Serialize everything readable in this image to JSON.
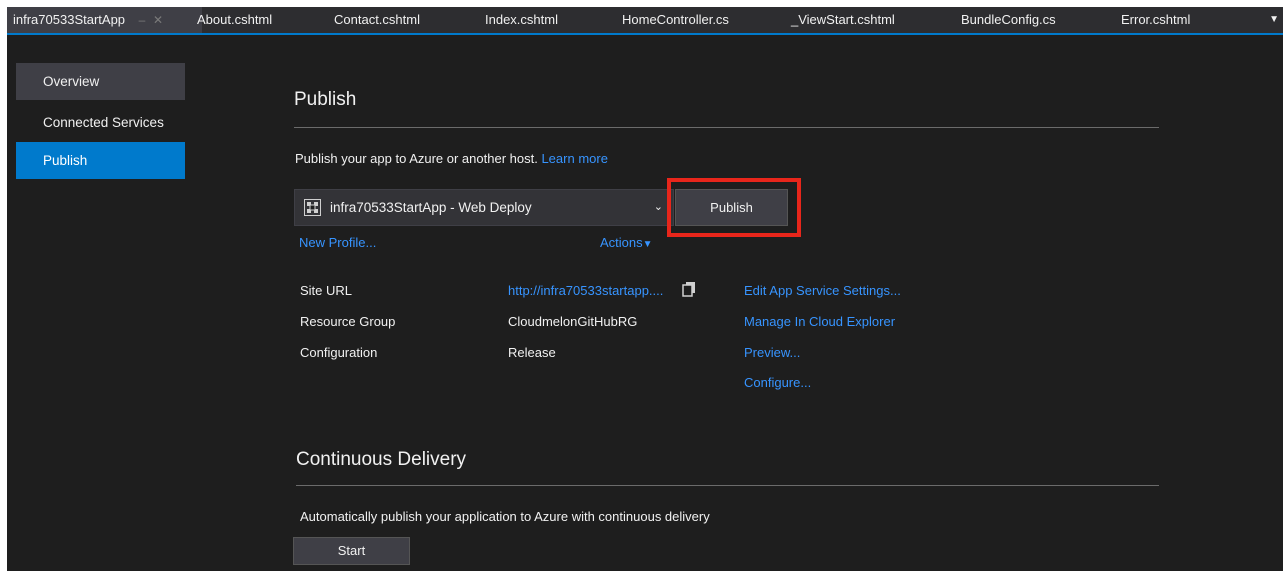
{
  "tabs": [
    {
      "label": "infra70533StartApp",
      "active": true
    },
    {
      "label": "About.cshtml"
    },
    {
      "label": "Contact.cshtml"
    },
    {
      "label": "Index.cshtml"
    },
    {
      "label": "HomeController.cs"
    },
    {
      "label": "_ViewStart.cshtml"
    },
    {
      "label": "BundleConfig.cs"
    },
    {
      "label": "Error.cshtml"
    }
  ],
  "tab_icons": {
    "pin": "pin-icon",
    "close": "close-icon",
    "overflow": "dropdown-arrow-icon"
  },
  "sidebar": {
    "items": [
      {
        "label": "Overview",
        "state": "hover"
      },
      {
        "label": "Connected Services"
      },
      {
        "label": "Publish",
        "state": "selected"
      }
    ]
  },
  "publish": {
    "title": "Publish",
    "description": "Publish your app to Azure or another host.",
    "learn_more": "Learn more",
    "profile": {
      "value": "infra70533StartApp - Web Deploy",
      "icon": "web-deploy-icon"
    },
    "publish_button": "Publish",
    "new_profile": "New Profile...",
    "actions": "Actions",
    "details": [
      {
        "label": "Site URL",
        "value": "http://infra70533startapp....",
        "is_link": true
      },
      {
        "label": "Resource Group",
        "value": "CloudmelonGitHubRG"
      },
      {
        "label": "Configuration",
        "value": "Release"
      }
    ],
    "links": [
      "Edit App Service Settings...",
      "Manage In Cloud Explorer",
      "Preview...",
      "Configure..."
    ]
  },
  "continuous_delivery": {
    "title": "Continuous Delivery",
    "description": "Automatically publish your application to Azure with continuous delivery",
    "start_button": "Start"
  },
  "colors": {
    "background": "#1e1e1e",
    "accent": "#007acc",
    "link": "#3794ff",
    "highlight": "#e8261b"
  }
}
